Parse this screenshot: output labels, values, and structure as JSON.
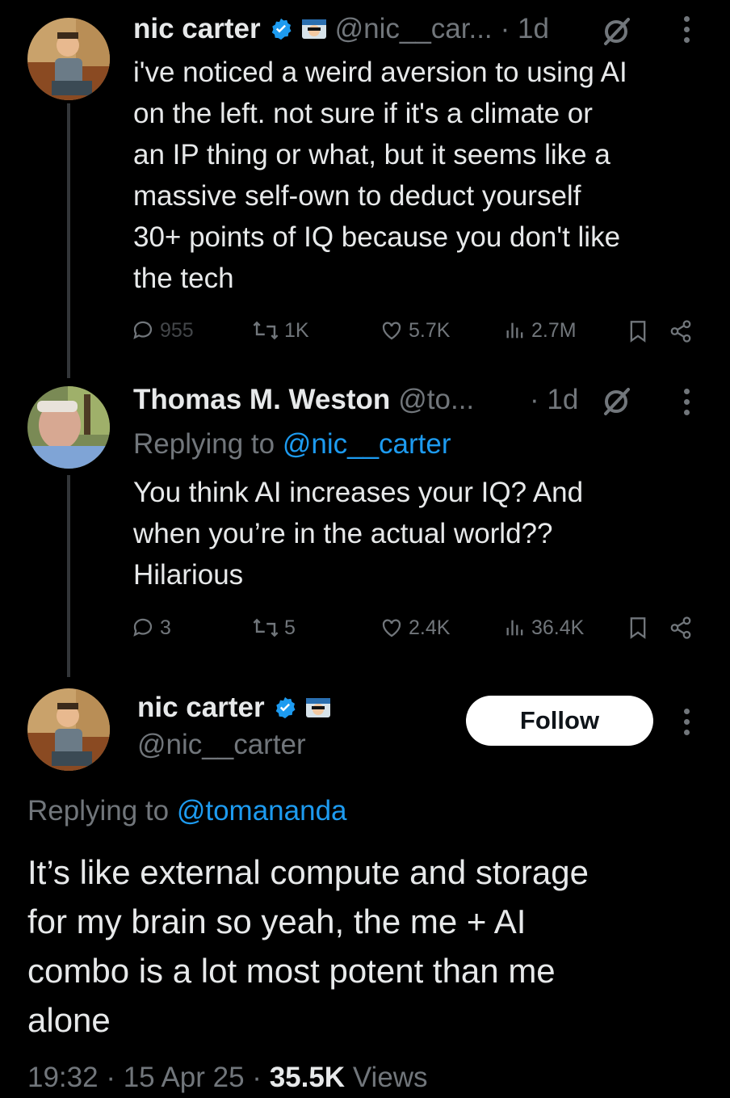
{
  "tweet1": {
    "name": "nic carter",
    "handle": "@nic__car...",
    "time": "· 1d",
    "lines": [
      "i've noticed a weird aversion to using AI",
      "on the left. not sure if it's a climate or",
      "an IP thing or what, but it seems like a",
      "massive self-own to deduct yourself",
      "30+ points of IQ because you don't like",
      "the tech"
    ],
    "replies": "955",
    "reposts": "1K",
    "likes": "5.7K",
    "views": "2.7M"
  },
  "tweet2": {
    "name": "Thomas M. Weston",
    "handle": "@to...",
    "time": "· 1d",
    "replying_prefix": "Replying to ",
    "replying_handle": "@nic__carter",
    "lines": [
      "You think AI increases your IQ? And",
      "when you’re in the actual world??",
      "Hilarious"
    ],
    "replies": "3",
    "reposts": "5",
    "likes": "2.4K",
    "views": "36.4K"
  },
  "main": {
    "name": "nic carter",
    "handle": "@nic__carter",
    "follow_label": "Follow",
    "replying_prefix": "Replying to ",
    "replying_handle": "@tomananda",
    "lines": [
      "It’s like external compute and storage",
      "for my brain so yeah, the me + AI",
      "combo is a lot most potent  than me",
      "alone"
    ],
    "time": "19:32",
    "date": "15 Apr 25",
    "views_count": "35.5K",
    "views_label": "Views",
    "separator": "·"
  },
  "colors": {
    "background": "#000000",
    "text": "#e7e9ea",
    "muted": "#71767b",
    "link": "#1d9bf0",
    "verified": "#1d9bf0"
  },
  "icons": [
    "verified-badge-icon",
    "sunglasses-emoji-icon",
    "grok-icon",
    "more-icon",
    "reply-icon",
    "repost-icon",
    "like-icon",
    "views-icon",
    "bookmark-icon",
    "share-icon"
  ]
}
